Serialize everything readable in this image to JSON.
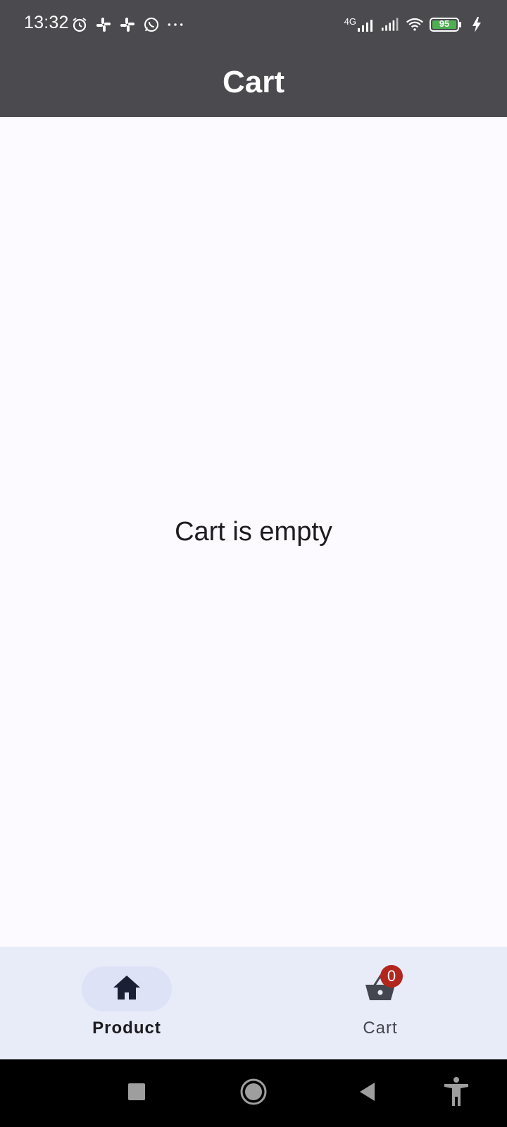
{
  "status_bar": {
    "time": "13:32",
    "network": "4G",
    "battery": "95",
    "icons_left": [
      "alarm-icon",
      "slack-icon",
      "slack-icon",
      "whatsapp-icon",
      "more-icon"
    ],
    "icons_right": [
      "signal-icon",
      "signal-icon",
      "wifi-icon",
      "battery-icon",
      "charging-icon"
    ]
  },
  "app_bar": {
    "title": "Cart"
  },
  "main": {
    "empty_message": "Cart is empty"
  },
  "bottom_nav": {
    "items": [
      {
        "label": "Product",
        "icon": "home-icon",
        "active": true
      },
      {
        "label": "Cart",
        "icon": "cart-basket-icon",
        "active": false,
        "badge": "0"
      }
    ]
  },
  "system_nav": {
    "buttons": [
      "recents-button",
      "home-button",
      "back-button",
      "accessibility-button"
    ]
  },
  "colors": {
    "app_bar_bg": "#4b4a4f",
    "badge": "#b3261e",
    "nav_bg": "#e8ecf8",
    "battery_fill": "#4caf50"
  }
}
